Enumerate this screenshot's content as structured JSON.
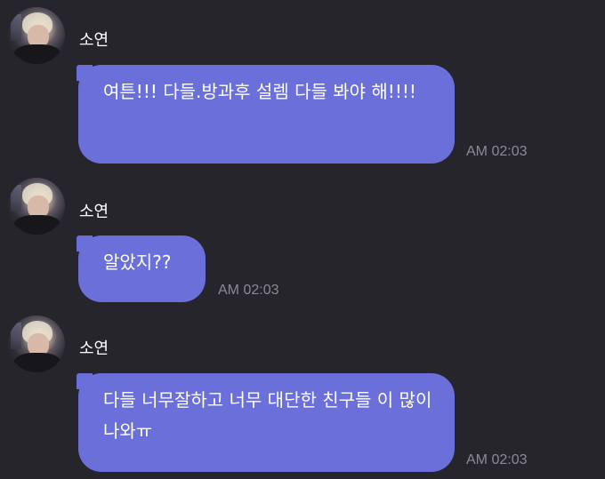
{
  "messages": [
    {
      "sender": "소연",
      "avatar_icon": "profile-photo",
      "text": "여튼!!! 다들.방과후 설렘 다들 봐야 해!!!!",
      "time": "AM 02:03"
    },
    {
      "sender": "소연",
      "avatar_icon": "profile-photo",
      "text": "알았지??",
      "time": "AM 02:03"
    },
    {
      "sender": "소연",
      "avatar_icon": "profile-photo",
      "text": "다들 너무잘하고 너무 대단한 친구들 이 많이나와ㅠ",
      "time": "AM 02:03"
    }
  ],
  "colors": {
    "background": "#26252c",
    "bubble": "#6b6fd9",
    "time_text": "#8b8a92"
  }
}
